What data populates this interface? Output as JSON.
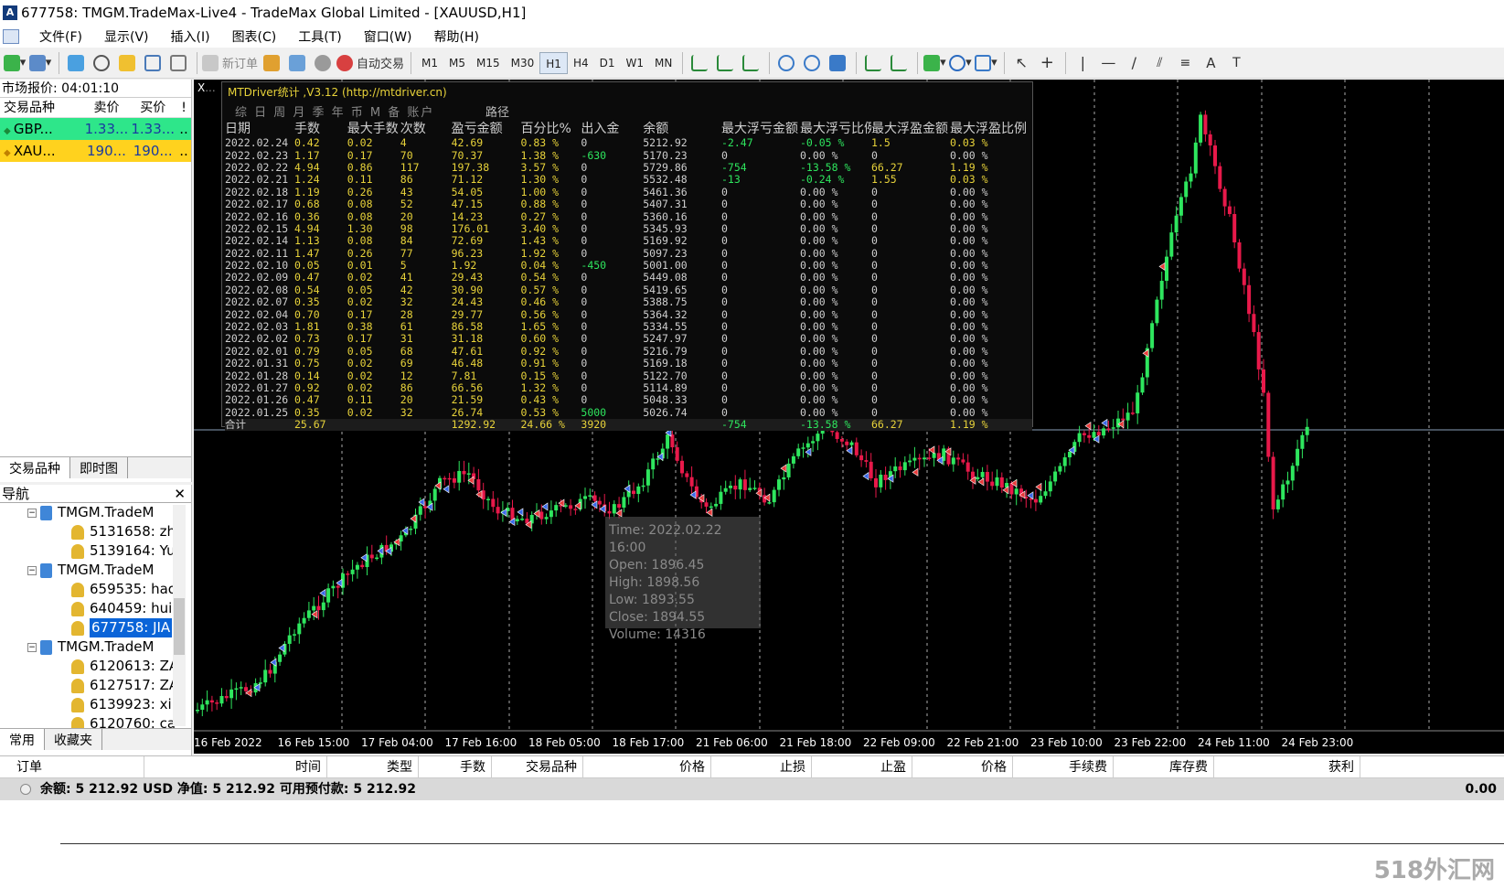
{
  "window": {
    "title": "677758: TMGM.TradeMax-Live4 - TradeMax Global Limited - [XAUUSD,H1]"
  },
  "menu": [
    "文件(F)",
    "显示(V)",
    "插入(I)",
    "图表(C)",
    "工具(T)",
    "窗口(W)",
    "帮助(H)"
  ],
  "toolbar": {
    "new_order": "新订单",
    "auto_trade": "自动交易",
    "timeframes": [
      "M1",
      "M5",
      "M15",
      "M30",
      "H1",
      "H4",
      "D1",
      "W1",
      "MN"
    ],
    "active_tf": "H1"
  },
  "market_watch": {
    "title": "市场报价: 04:01:10",
    "col_symbol": "交易品种",
    "col_bid": "卖价",
    "col_ask": "买价",
    "col_flag": "!",
    "rows": [
      {
        "symbol": "GBP...",
        "bid": "1.33...",
        "ask": "1.33...",
        "flag": "..",
        "color": "#2ee68a"
      },
      {
        "symbol": "XAU...",
        "bid": "190...",
        "ask": "190...",
        "flag": "..",
        "color": "#ffd21e"
      }
    ],
    "tabs": [
      "交易品种",
      "即时图"
    ]
  },
  "navigator": {
    "title": "导航",
    "items": [
      {
        "type": "acc",
        "text": "TMGM.TradeM",
        "indent": 30
      },
      {
        "type": "usr",
        "text": "5131658: zh",
        "indent": 78
      },
      {
        "type": "usr",
        "text": "5139164: Yu",
        "indent": 78
      },
      {
        "type": "acc",
        "text": "TMGM.TradeM",
        "indent": 30
      },
      {
        "type": "usr",
        "text": "659535: hao",
        "indent": 78
      },
      {
        "type": "usr",
        "text": "640459: hui",
        "indent": 78
      },
      {
        "type": "usr",
        "text": "677758: JIA",
        "indent": 78,
        "selected": true
      },
      {
        "type": "acc",
        "text": "TMGM.TradeM",
        "indent": 30
      },
      {
        "type": "usr",
        "text": "6120613: ZA",
        "indent": 78
      },
      {
        "type": "usr",
        "text": "6127517: ZA",
        "indent": 78
      },
      {
        "type": "usr",
        "text": "6139923: xi",
        "indent": 78
      },
      {
        "type": "usr",
        "text": "6120760: ca",
        "indent": 78
      }
    ],
    "tabs": [
      "常用",
      "收藏夹"
    ]
  },
  "chart": {
    "symbol_label": "XAUUSD,H1",
    "stats": {
      "title": "MTDriver统计 ,V3.12 (http://mtdriver.cn)",
      "path_label": "路径",
      "tabs_label": "综 日 周 月 季 年 币 M 备 账户",
      "headers": [
        "日期",
        "手数",
        "最大手数",
        "次数",
        "盈亏金额",
        "百分比%",
        "出入金",
        "余额",
        "最大浮亏金额",
        "最大浮亏比例",
        "最大浮盈金额",
        "最大浮盈比例"
      ],
      "rows": [
        [
          "2022.02.24",
          "0.42",
          "0.02",
          "4",
          "42.69",
          "0.83 %",
          "0",
          "5212.92",
          "-2.47",
          "-0.05 %",
          "1.5",
          "0.03 %"
        ],
        [
          "2022.02.23",
          "1.17",
          "0.17",
          "70",
          "70.37",
          "1.38 %",
          "-630",
          "5170.23",
          "0",
          "0.00 %",
          "0",
          "0.00 %"
        ],
        [
          "2022.02.22",
          "4.94",
          "0.86",
          "117",
          "197.38",
          "3.57 %",
          "0",
          "5729.86",
          "-754",
          "-13.58 %",
          "66.27",
          "1.19 %"
        ],
        [
          "2022.02.21",
          "1.24",
          "0.11",
          "86",
          "71.12",
          "1.30 %",
          "0",
          "5532.48",
          "-13",
          "-0.24 %",
          "1.55",
          "0.03 %"
        ],
        [
          "2022.02.18",
          "1.19",
          "0.26",
          "43",
          "54.05",
          "1.00 %",
          "0",
          "5461.36",
          "0",
          "0.00 %",
          "0",
          "0.00 %"
        ],
        [
          "2022.02.17",
          "0.68",
          "0.08",
          "52",
          "47.15",
          "0.88 %",
          "0",
          "5407.31",
          "0",
          "0.00 %",
          "0",
          "0.00 %"
        ],
        [
          "2022.02.16",
          "0.36",
          "0.08",
          "20",
          "14.23",
          "0.27 %",
          "0",
          "5360.16",
          "0",
          "0.00 %",
          "0",
          "0.00 %"
        ],
        [
          "2022.02.15",
          "4.94",
          "1.30",
          "98",
          "176.01",
          "3.40 %",
          "0",
          "5345.93",
          "0",
          "0.00 %",
          "0",
          "0.00 %"
        ],
        [
          "2022.02.14",
          "1.13",
          "0.08",
          "84",
          "72.69",
          "1.43 %",
          "0",
          "5169.92",
          "0",
          "0.00 %",
          "0",
          "0.00 %"
        ],
        [
          "2022.02.11",
          "1.47",
          "0.26",
          "77",
          "96.23",
          "1.92 %",
          "0",
          "5097.23",
          "0",
          "0.00 %",
          "0",
          "0.00 %"
        ],
        [
          "2022.02.10",
          "0.05",
          "0.01",
          "5",
          "1.92",
          "0.04 %",
          "-450",
          "5001.00",
          "0",
          "0.00 %",
          "0",
          "0.00 %"
        ],
        [
          "2022.02.09",
          "0.47",
          "0.02",
          "41",
          "29.43",
          "0.54 %",
          "0",
          "5449.08",
          "0",
          "0.00 %",
          "0",
          "0.00 %"
        ],
        [
          "2022.02.08",
          "0.54",
          "0.05",
          "42",
          "30.90",
          "0.57 %",
          "0",
          "5419.65",
          "0",
          "0.00 %",
          "0",
          "0.00 %"
        ],
        [
          "2022.02.07",
          "0.35",
          "0.02",
          "32",
          "24.43",
          "0.46 %",
          "0",
          "5388.75",
          "0",
          "0.00 %",
          "0",
          "0.00 %"
        ],
        [
          "2022.02.04",
          "0.70",
          "0.17",
          "28",
          "29.77",
          "0.56 %",
          "0",
          "5364.32",
          "0",
          "0.00 %",
          "0",
          "0.00 %"
        ],
        [
          "2022.02.03",
          "1.81",
          "0.38",
          "61",
          "86.58",
          "1.65 %",
          "0",
          "5334.55",
          "0",
          "0.00 %",
          "0",
          "0.00 %"
        ],
        [
          "2022.02.02",
          "0.73",
          "0.17",
          "31",
          "31.18",
          "0.60 %",
          "0",
          "5247.97",
          "0",
          "0.00 %",
          "0",
          "0.00 %"
        ],
        [
          "2022.02.01",
          "0.79",
          "0.05",
          "68",
          "47.61",
          "0.92 %",
          "0",
          "5216.79",
          "0",
          "0.00 %",
          "0",
          "0.00 %"
        ],
        [
          "2022.01.31",
          "0.75",
          "0.02",
          "69",
          "46.48",
          "0.91 %",
          "0",
          "5169.18",
          "0",
          "0.00 %",
          "0",
          "0.00 %"
        ],
        [
          "2022.01.28",
          "0.14",
          "0.02",
          "12",
          "7.81",
          "0.15 %",
          "0",
          "5122.70",
          "0",
          "0.00 %",
          "0",
          "0.00 %"
        ],
        [
          "2022.01.27",
          "0.92",
          "0.02",
          "86",
          "66.56",
          "1.32 %",
          "0",
          "5114.89",
          "0",
          "0.00 %",
          "0",
          "0.00 %"
        ],
        [
          "2022.01.26",
          "0.47",
          "0.11",
          "20",
          "21.59",
          "0.43 %",
          "0",
          "5048.33",
          "0",
          "0.00 %",
          "0",
          "0.00 %"
        ],
        [
          "2022.01.25",
          "0.35",
          "0.02",
          "32",
          "26.74",
          "0.53 %",
          "5000",
          "5026.74",
          "0",
          "0.00 %",
          "0",
          "0.00 %"
        ]
      ],
      "total": [
        "合计",
        "25.67",
        "",
        "",
        "1292.92",
        "24.66 %",
        "3920",
        "",
        "-754",
        "-13.58 %",
        "66.27",
        "1.19 %"
      ]
    },
    "tooltip": {
      "time": "Time: 2022.02.22 16:00",
      "open": "Open: 1896.45",
      "high": "High: 1898.56",
      "low": "Low:  1893.55",
      "close": "Close: 1894.55",
      "volume": "Volume: 14316"
    },
    "x_labels": [
      "16 Feb 2022",
      "16 Feb 15:00",
      "17 Feb 04:00",
      "17 Feb 16:00",
      "18 Feb 05:00",
      "18 Feb 17:00",
      "21 Feb 06:00",
      "21 Feb 18:00",
      "22 Feb 09:00",
      "22 Feb 21:00",
      "23 Feb 10:00",
      "23 Feb 22:00",
      "24 Feb 11:00",
      "24 Feb 23:00"
    ],
    "colors": {
      "up": "#2ee65e",
      "down": "#e8194a",
      "bg": "#000000"
    }
  },
  "terminal": {
    "columns": [
      "订单",
      "时间",
      "类型",
      "手数",
      "交易品种",
      "价格",
      "止损",
      "止盈",
      "价格",
      "手续费",
      "库存费",
      "获利"
    ],
    "balance_line": "余额: 5 212.92 USD  净值: 5 212.92  可用预付款: 5 212.92",
    "profit": "0.00"
  },
  "watermark": "518外汇网"
}
